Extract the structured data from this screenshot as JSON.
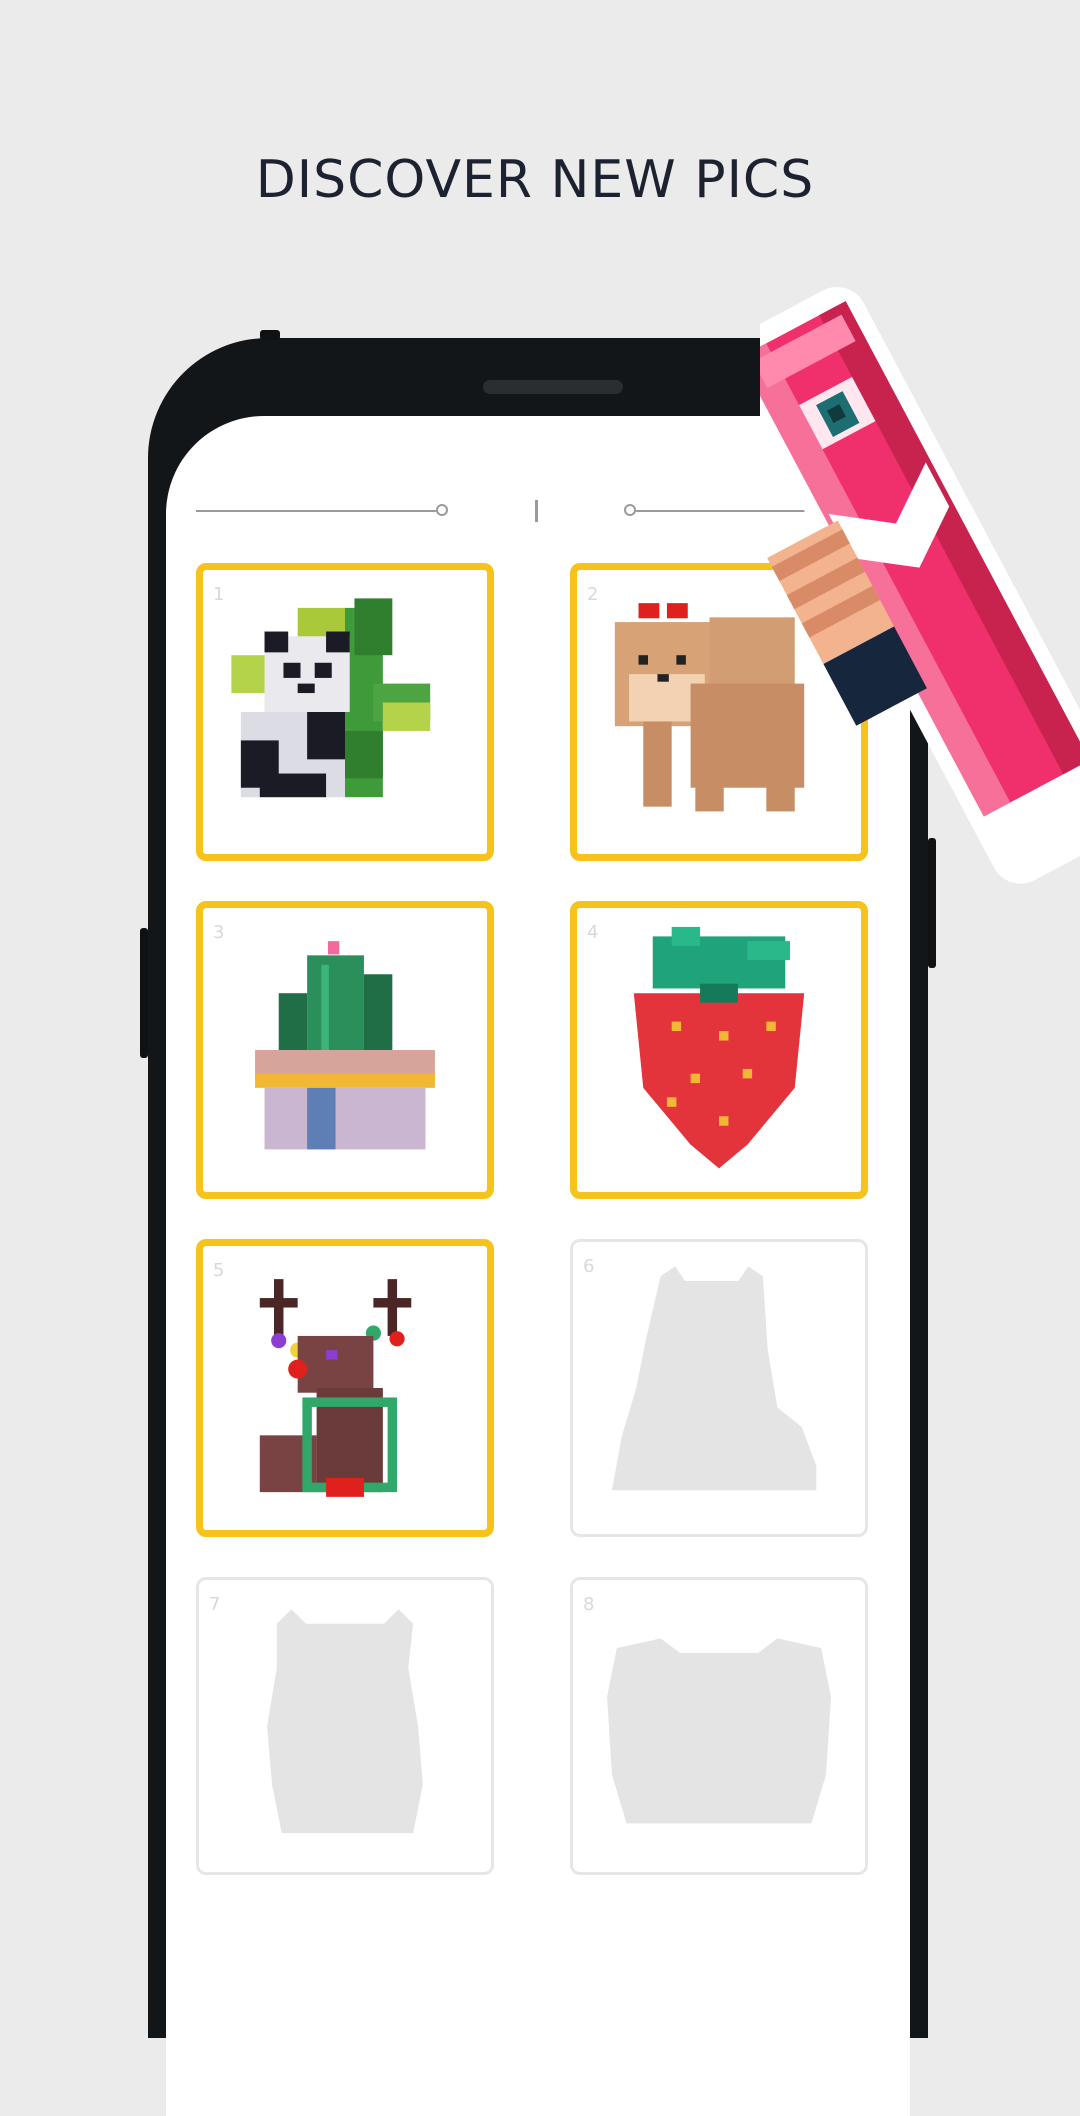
{
  "headline": "DISCOVER NEW PICS",
  "colors": {
    "background": "#ebebeb",
    "headline": "#1c2230",
    "completed_border": "#f6c31d",
    "locked_border": "#e6e6e6",
    "silhouette": "#e4e4e4",
    "pencil_pink": "#f0306c"
  },
  "pictures": [
    {
      "number": "1",
      "subject": "panda-on-cactus",
      "status": "completed"
    },
    {
      "number": "2",
      "subject": "pomeranian-dog",
      "status": "completed"
    },
    {
      "number": "3",
      "subject": "potted-cactus",
      "status": "completed"
    },
    {
      "number": "4",
      "subject": "strawberry",
      "status": "completed"
    },
    {
      "number": "5",
      "subject": "reindeer",
      "status": "completed"
    },
    {
      "number": "6",
      "subject": "cat-silhouette",
      "status": "locked"
    },
    {
      "number": "7",
      "subject": "llama-silhouette",
      "status": "locked"
    },
    {
      "number": "8",
      "subject": "bear-silhouette",
      "status": "locked"
    }
  ]
}
